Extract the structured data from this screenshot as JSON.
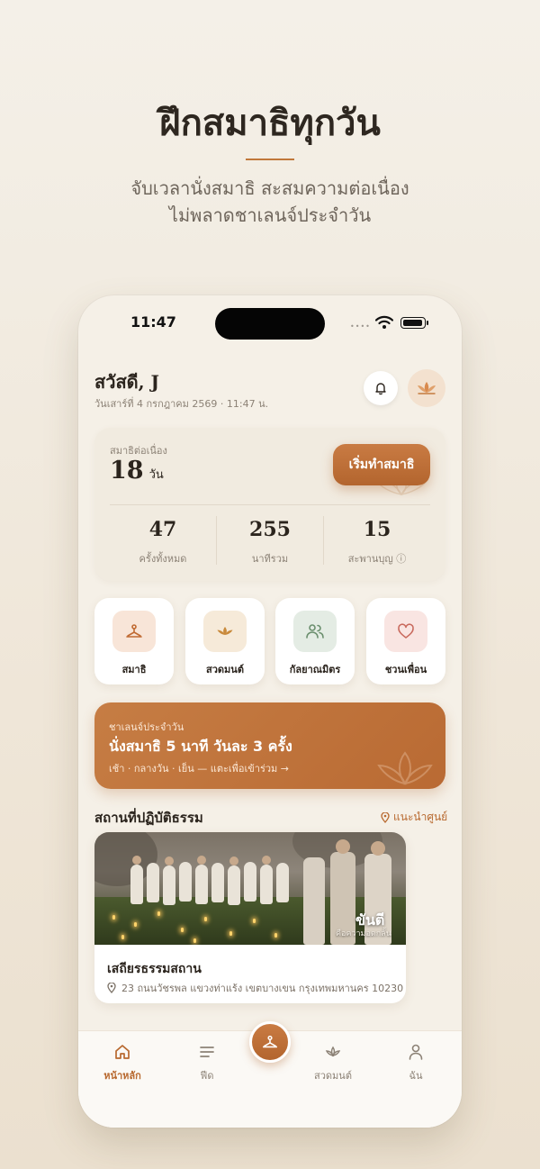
{
  "hero": {
    "title": "ฝึกสมาธิทุกวัน",
    "subtitle_line1": "จับเวลานั่งสมาธิ สะสมความต่อเนื่อง",
    "subtitle_line2": "ไม่พลาดชาเลนจ์ประจำวัน"
  },
  "status_bar": {
    "time": "11:47",
    "signal_dots": "••••"
  },
  "greeting": {
    "name": "สวัสดี, J",
    "date": "วันเสาร์ที่ 4 กรกฎาคม 2569 · 11:47 น."
  },
  "streak": {
    "label": "สมาธิต่อเนื่อง",
    "value": "18",
    "unit": "วัน",
    "start_button": "เริ่มทำสมาธิ"
  },
  "stats": [
    {
      "value": "47",
      "label": "ครั้งทั้งหมด"
    },
    {
      "value": "255",
      "label": "นาทีรวม"
    },
    {
      "value": "15",
      "label": "สะพานบุญ ⓘ"
    }
  ],
  "quick_actions": [
    {
      "label": "สมาธิ",
      "icon": "meditation-icon",
      "bg": "#f8e5d8"
    },
    {
      "label": "สวดมนต์",
      "icon": "lotus-icon",
      "bg": "#f6ead9"
    },
    {
      "label": "กัลยาณมิตร",
      "icon": "friends-icon",
      "bg": "#e4ece4"
    },
    {
      "label": "ชวนเพื่อน",
      "icon": "heart-icon",
      "bg": "#f9e5e2"
    }
  ],
  "challenge": {
    "label": "ชาเลนจ์ประจำวัน",
    "title": "นั่งสมาธิ 5 นาที วันละ 3 ครั้ง",
    "subtitle": "เช้า · กลางวัน · เย็น — แตะเพื่อเข้าร่วม →"
  },
  "places_section": {
    "title": "สถานที่ปฏิบัติธรรม",
    "link": "แนะนำศูนย์"
  },
  "place": {
    "image_overlay_title": "ขันตี",
    "image_overlay_sub": "คือความอดกลั้น",
    "name": "เสถียรธรรมสถาน",
    "address": "23 ถนนวัชรพล แขวงท่าแร้ง เขตบางเขน กรุงเทพมหานคร 10230"
  },
  "tabs": [
    {
      "label": "หน้าหลัก",
      "icon": "home-icon",
      "active": true
    },
    {
      "label": "ฟีด",
      "icon": "feed-icon",
      "active": false
    },
    {
      "label": "สวดมนต์",
      "icon": "lotus-icon",
      "active": false
    },
    {
      "label": "ฉัน",
      "icon": "profile-icon",
      "active": false
    }
  ],
  "colors": {
    "accent": "#b8692f",
    "background": "#f5f0e7",
    "text": "#2b241d"
  }
}
